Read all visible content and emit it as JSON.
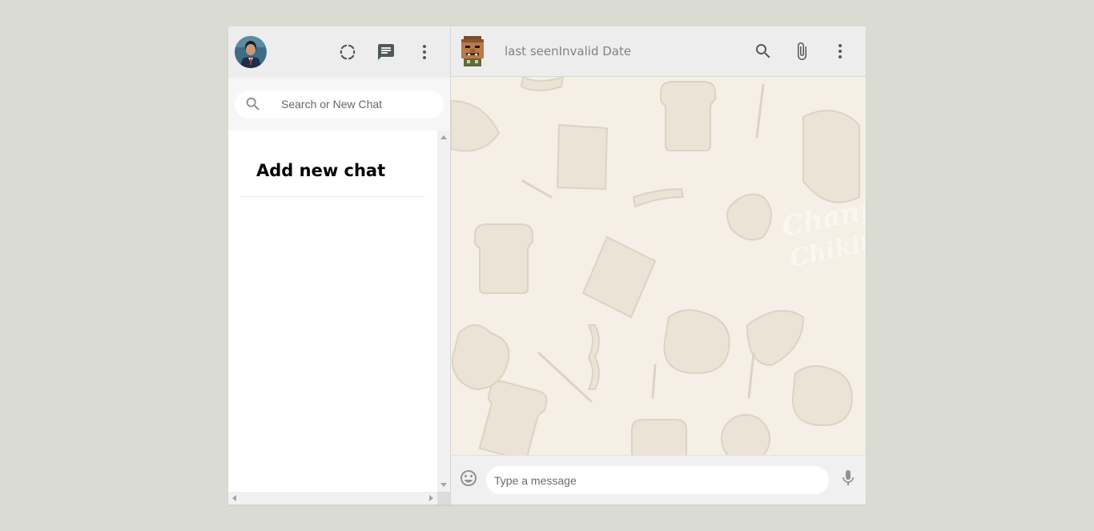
{
  "sidebar": {
    "header": {
      "avatar": "user-avatar",
      "icons": [
        "status-icon",
        "new-chat-icon",
        "more-vert-icon"
      ]
    },
    "search": {
      "placeholder": "Search or New Chat",
      "icon": "search-icon"
    },
    "add_chat_label": "Add new chat"
  },
  "chat": {
    "header": {
      "last_seen_label": "last seen",
      "last_seen_value": "Invalid Date",
      "icons": [
        "search-icon",
        "attach-icon",
        "more-vert-icon"
      ]
    },
    "wallpaper_text": [
      "Chanpu",
      "Chikito"
    ],
    "footer": {
      "placeholder": "Type a message",
      "icons": [
        "emoji-icon",
        "mic-icon"
      ]
    }
  },
  "colors": {
    "page_bg": "#dadbd3",
    "panel_bg": "#ededed",
    "chat_bg": "#f5efe6",
    "icon": "#51585c"
  }
}
